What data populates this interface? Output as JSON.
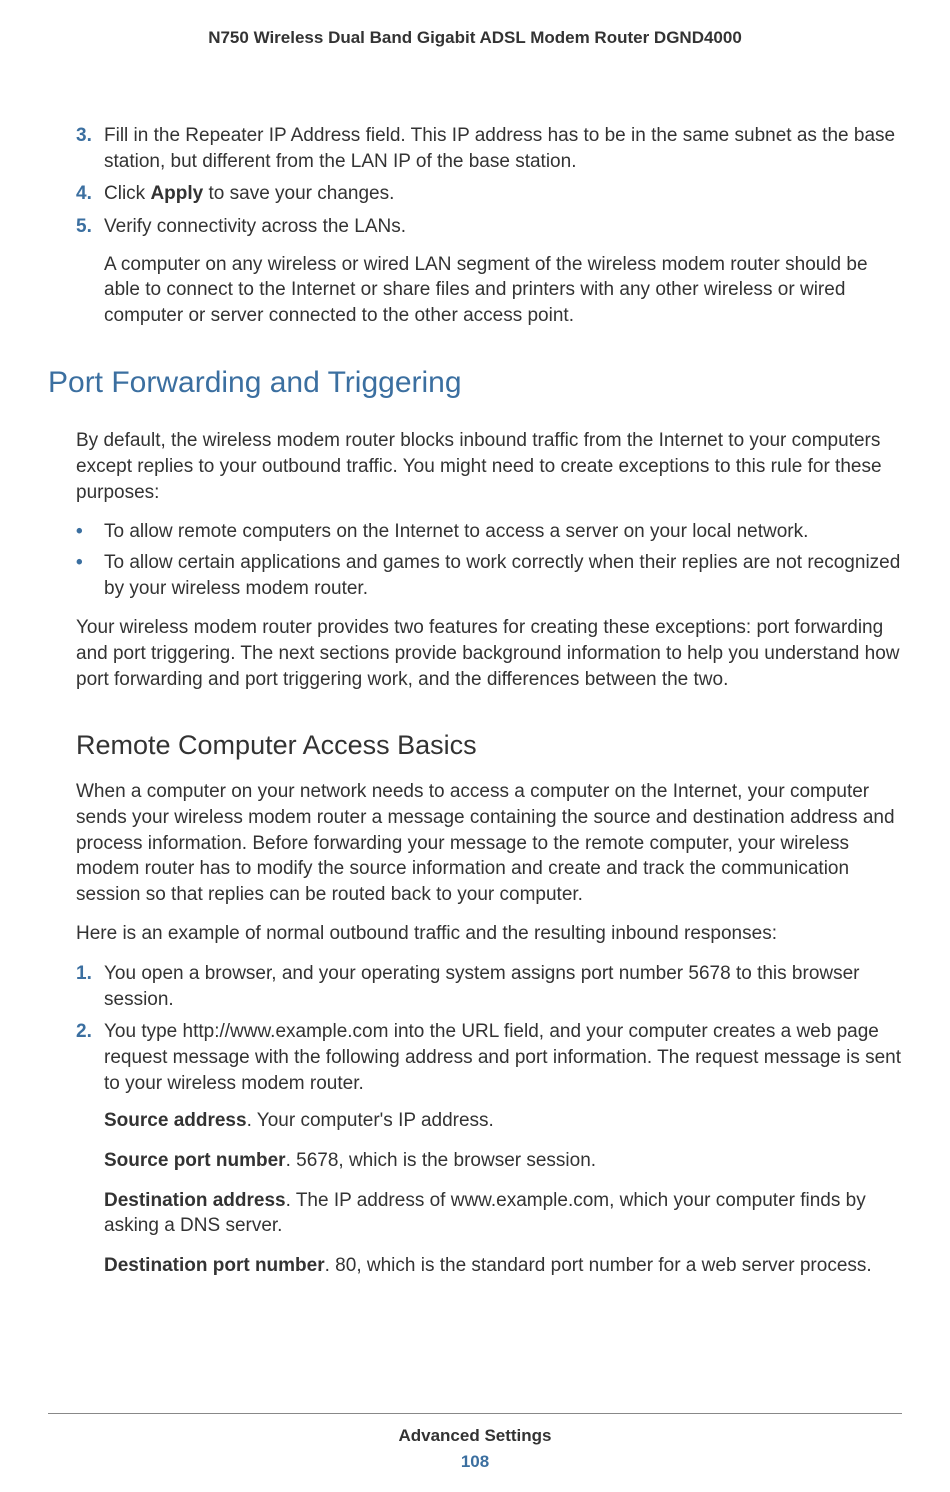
{
  "header": {
    "title": "N750 Wireless Dual Band Gigabit ADSL Modem Router DGND4000"
  },
  "top_steps": [
    {
      "num": "3.",
      "text_parts": [
        {
          "text": "Fill in the Repeater IP Address field. This IP address has to be in the same subnet as the base station, but different from the LAN IP of the base station.",
          "bold": false
        }
      ]
    },
    {
      "num": "4.",
      "text_parts": [
        {
          "text": "Click ",
          "bold": false
        },
        {
          "text": "Apply",
          "bold": true
        },
        {
          "text": " to save your changes.",
          "bold": false
        }
      ]
    },
    {
      "num": "5.",
      "text_parts": [
        {
          "text": "Verify connectivity across the LANs.",
          "bold": false
        }
      ]
    }
  ],
  "top_steps_subtext": "A computer on any wireless or wired LAN segment of the wireless modem router should be able to connect to the Internet or share files and printers with any other wireless or wired computer or server connected to the other access point.",
  "section_h1": "Port Forwarding and Triggering",
  "para1": "By default, the wireless modem router blocks inbound traffic from the Internet to your computers except replies to your outbound traffic. You might need to create exceptions to this rule for these purposes:",
  "bullets": [
    "To allow remote computers on the Internet to access a server on your local network.",
    "To allow certain applications and games to work correctly when their replies are not recognized by your wireless modem router."
  ],
  "para2": "Your wireless modem router provides two features for creating these exceptions: port forwarding and port triggering. The next sections provide background information to help you understand how port forwarding and port triggering work, and the differences between the two.",
  "section_h2": "Remote Computer Access Basics",
  "para3": "When a computer on your network needs to access a computer on the Internet, your computer sends your wireless modem router a message containing the source and destination address and process information. Before forwarding your message to the remote computer, your wireless modem router has to modify the source information and create and track the communication session so that replies can be routed back to your computer.",
  "para4": "Here is an example of normal outbound traffic and the resulting inbound responses:",
  "example_steps": [
    {
      "num": "1.",
      "text": "You open a browser, and your operating system assigns port number 5678 to this browser session."
    },
    {
      "num": "2.",
      "text": "You type http://www.example.com into the URL field, and your computer creates a web page request message with the following address and port information. The request message is sent to your wireless modem router."
    }
  ],
  "definitions": [
    {
      "label": "Source address",
      "text": ". Your computer's IP address."
    },
    {
      "label": "Source port number",
      "text": ". 5678, which is the browser session."
    },
    {
      "label": "Destination address",
      "text": ". The IP address of www.example.com, which your computer finds by asking a DNS server."
    },
    {
      "label": "Destination port number",
      "text": ". 80, which is the standard port number for a web server process."
    }
  ],
  "footer": {
    "section": "Advanced Settings",
    "page": "108"
  }
}
